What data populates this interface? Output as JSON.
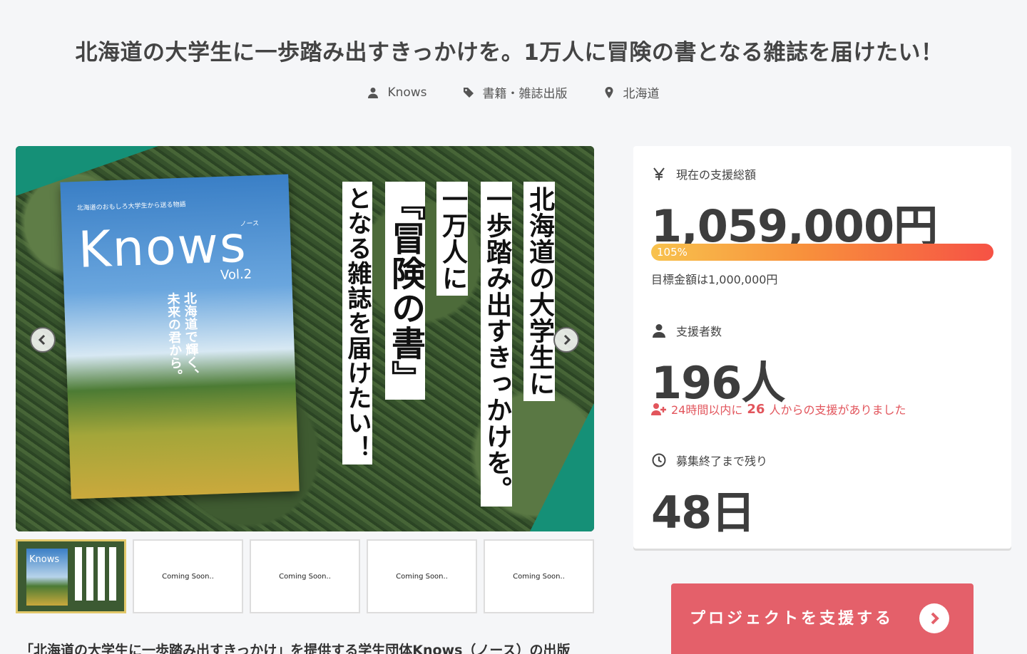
{
  "project": {
    "title": "北海道の大学生に一歩踏み出すきっかけを。1万人に冒険の書となる雑誌を届けたい！",
    "owner": "Knows",
    "category": "書籍・雑誌出版",
    "location": "北海道"
  },
  "hero": {
    "magazine_small": "北海道のおもしろ大学生から送る物語",
    "magazine_logo": "Knows",
    "magazine_sub": "ノース",
    "magazine_vol": "Vol.2",
    "magazine_tagline": "北海道で輝く、\n未来の君から。",
    "columns": [
      "北海道の大学生に",
      "一歩踏み出すきっかけを。",
      "一万人に",
      "『冒険の書』",
      "となる雑誌を届けたい！"
    ]
  },
  "thumbnails": {
    "first_logo": "Knows",
    "coming_soon": [
      "Coming Soon..",
      "Coming Soon..",
      "Coming Soon..",
      "Coming Soon.."
    ]
  },
  "excerpt": "「北海道の大学生に一歩踏み出すきっかけ」を提供する学生団体Knows（ノース）の出版",
  "stats": {
    "amount_label": "現在の支援総額",
    "amount_value": "1,059,000円",
    "progress_text": "105%",
    "progress_percent": 105,
    "goal_text": "目標金額は1,000,000円",
    "supporters_label": "支援者数",
    "supporters_value": "196人",
    "recent_prefix": "24時間以内に",
    "recent_count": "26",
    "recent_suffix": "人からの支援がありました",
    "remaining_label": "募集終了まで残り",
    "remaining_value": "48日"
  },
  "cta": {
    "label": "プロジェクトを支援する"
  },
  "colors": {
    "accent": "#e4606a",
    "teal": "#159077",
    "progress_start": "#f8c24d",
    "progress_end": "#f65245"
  }
}
